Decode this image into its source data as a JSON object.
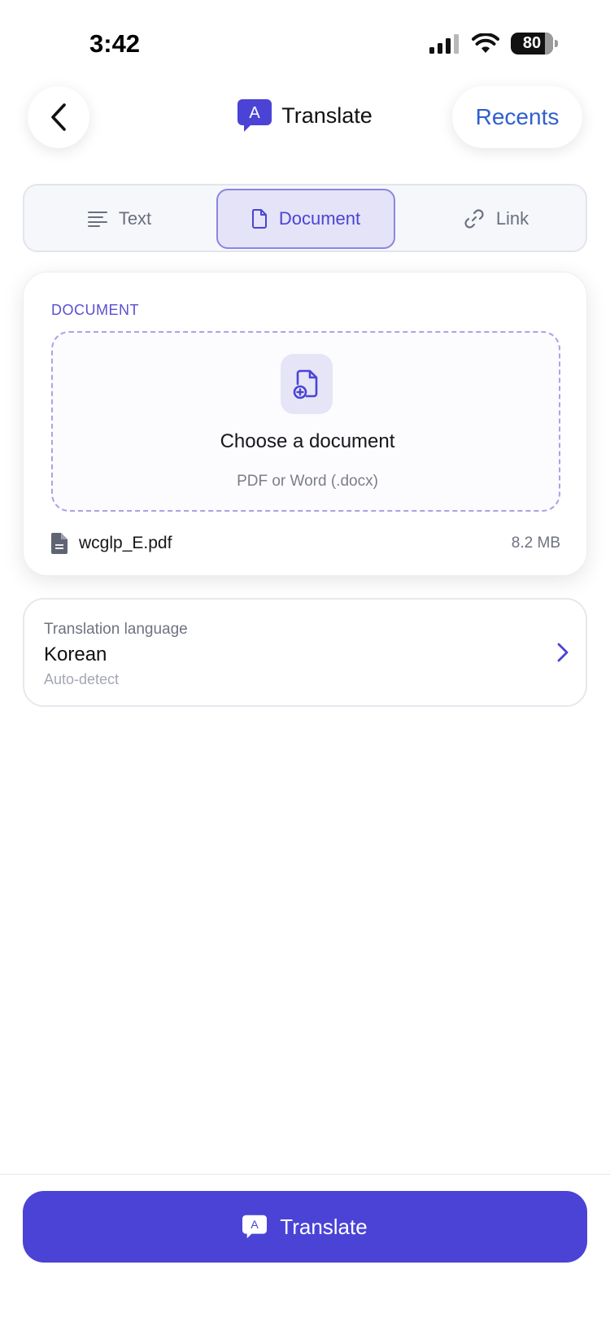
{
  "status_bar": {
    "time": "3:42",
    "battery": "80"
  },
  "header": {
    "title": "Translate",
    "recents_label": "Recents"
  },
  "tabs": [
    {
      "label": "Text",
      "icon": "lines-icon",
      "selected": false
    },
    {
      "label": "Document",
      "icon": "document-icon",
      "selected": true
    },
    {
      "label": "Link",
      "icon": "link-icon",
      "selected": false
    }
  ],
  "document": {
    "section_label": "DOCUMENT",
    "dropzone_title": "Choose a document",
    "dropzone_subtitle": "PDF or Word (.docx)",
    "file_name": "wcglp_E.pdf",
    "file_size": "8.2 MB"
  },
  "language": {
    "caption": "Translation language",
    "value": "Korean",
    "subtitle": "Auto-detect"
  },
  "action": {
    "translate_label": "Translate"
  },
  "colors": {
    "accent": "#4a43d6",
    "link": "#2f5fcf"
  }
}
